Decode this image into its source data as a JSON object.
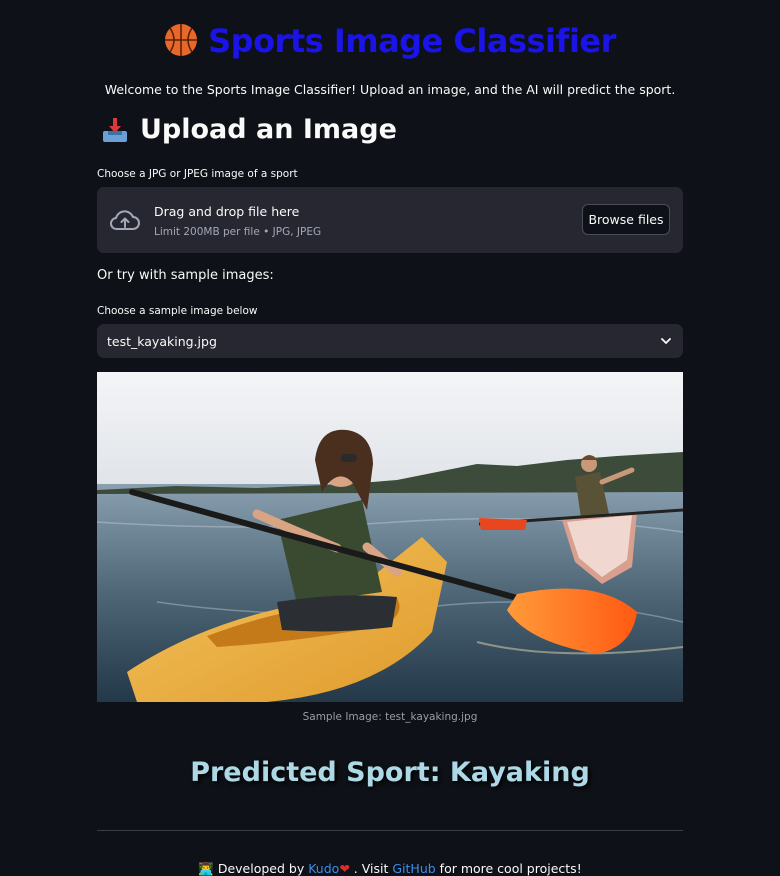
{
  "header": {
    "title": "Sports Image Classifier",
    "title_icon": "basketball-icon",
    "welcome": "Welcome to the Sports Image Classifier! Upload an image, and the AI will predict the sport."
  },
  "upload": {
    "heading": "Upload an Image",
    "heading_icon": "inbox-tray-icon",
    "label": "Choose a JPG or JPEG image of a sport",
    "drag_text": "Drag and drop file here",
    "limit_text": "Limit 200MB per file • JPG, JPEG",
    "browse_label": "Browse files"
  },
  "samples": {
    "or_try": "Or try with sample images:",
    "select_label": "Choose a sample image below",
    "selected": "test_kayaking.jpg",
    "caption": "Sample Image: test_kayaking.jpg"
  },
  "prediction": {
    "text": "Predicted Sport: Kayaking"
  },
  "footer": {
    "icon": "technologist-icon",
    "prefix": "Developed by",
    "author": "Kudo",
    "heart": "❤",
    "visit": ". Visit",
    "github": "GitHub",
    "suffix": "for more cool projects!"
  },
  "colors": {
    "background": "#0e1117",
    "title": "#1a14e8",
    "prediction": "#add8e6",
    "link": "#3b8eea"
  }
}
